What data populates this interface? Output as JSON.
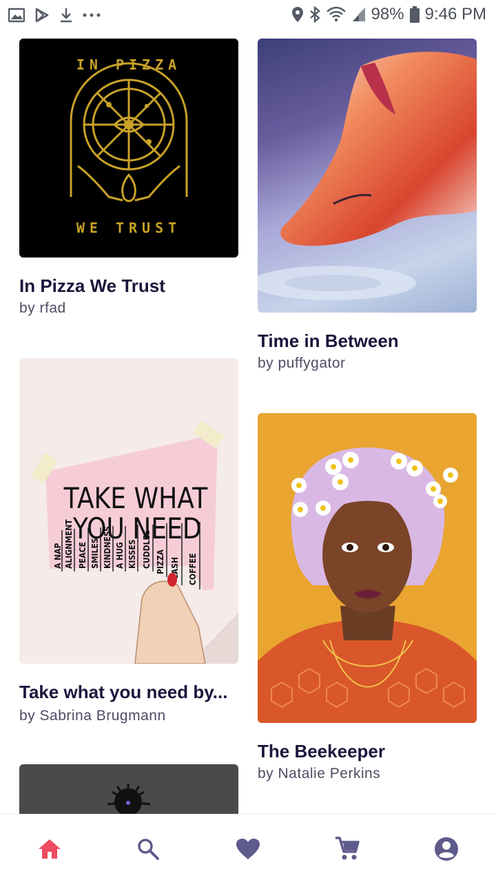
{
  "status_bar": {
    "battery": "98%",
    "time": "9:46 PM",
    "icons": [
      "gallery-icon",
      "play-store-icon",
      "download-icon",
      "more-dots-icon",
      "location-icon",
      "bluetooth-icon",
      "wifi-icon",
      "signal-icon",
      "battery-icon"
    ]
  },
  "feed": {
    "items": [
      {
        "title": "In Pizza We Trust",
        "artist": "by rfad"
      },
      {
        "title": "Time in Between",
        "artist": "by puffygator"
      },
      {
        "title": "Take what you need by...",
        "artist": "by Sabrina Brugmann"
      },
      {
        "title": "The Beekeeper",
        "artist": "by Natalie Perkins"
      }
    ],
    "artwork_text": {
      "pizza_top": "IN PIZZA",
      "pizza_bottom": "WE TRUST",
      "note_headline_1": "TAKE WHAT",
      "note_headline_2": "YOU NEED",
      "note_tabs": [
        "A NAP",
        "ALIGNMENT",
        "PEACE",
        "SMILES",
        "KINDNESS",
        "A HUG",
        "KISSES",
        "CUDDLES",
        "PIZZA",
        "CASH",
        "COFFEE"
      ]
    }
  },
  "bottom_nav": {
    "items": [
      "home-icon",
      "search-icon",
      "heart-icon",
      "cart-icon",
      "account-icon"
    ],
    "active": "home",
    "active_color": "#ef4b5f",
    "inactive_color": "#5e5a8a"
  }
}
